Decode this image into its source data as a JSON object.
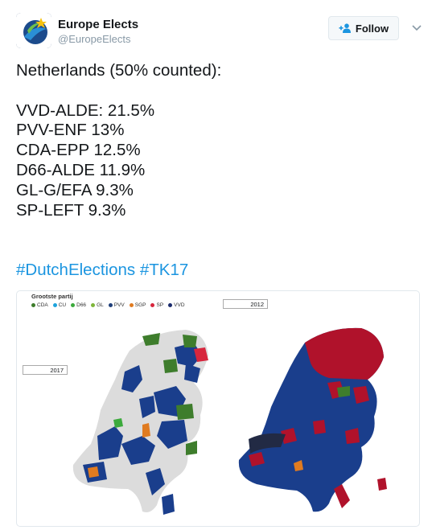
{
  "account": {
    "name": "Europe Elects",
    "handle": "@EuropeElects",
    "follow_label": "Follow"
  },
  "tweet": {
    "lines": [
      "Netherlands (50% counted):",
      "",
      "VVD-ALDE: 21.5%",
      "PVV-ENF 13%",
      "CDA-EPP 12.5%",
      "D66-ALDE 11.9%",
      "GL-G/EFA 9.3%",
      "SP-LEFT 9.3%"
    ],
    "hashtags": [
      "#DutchElections",
      "#TK17"
    ]
  },
  "media": {
    "legend_title": "Grootste partij",
    "legend": [
      {
        "label": "CDA",
        "color": "#3e7d2c"
      },
      {
        "label": "CU",
        "color": "#1ea3dc"
      },
      {
        "label": "D66",
        "color": "#3caa3c"
      },
      {
        "label": "GL",
        "color": "#7fb539"
      },
      {
        "label": "PVV",
        "color": "#1f3f7a"
      },
      {
        "label": "SGP",
        "color": "#e07b20"
      },
      {
        "label": "SP",
        "color": "#d7263d"
      },
      {
        "label": "VVD",
        "color": "#1a2a6c"
      }
    ],
    "year_left": "2017",
    "year_right": "2012"
  },
  "colors": {
    "link": "#1b95e0",
    "map_blue": "#1a3e8c",
    "map_red": "#b0122b",
    "map_grey": "#dcdcdc"
  }
}
